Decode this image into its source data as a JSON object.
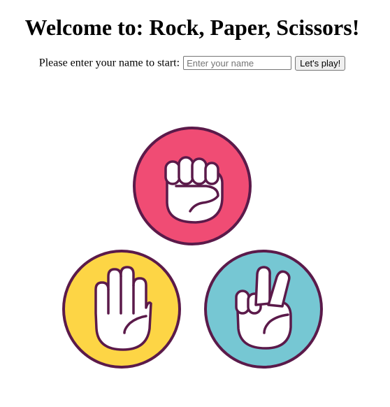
{
  "page": {
    "title": "Welcome to: Rock, Paper, Scissors!"
  },
  "name_form": {
    "prompt": "Please enter your name to start:",
    "input_placeholder": "Enter your name",
    "input_value": "",
    "button_label": "Let's play!"
  },
  "hands": [
    {
      "icon": "rock-fist-icon",
      "circle_color": "#f04c74"
    },
    {
      "icon": "paper-open-hand-icon",
      "circle_color": "#fdd545"
    },
    {
      "icon": "scissors-peace-hand-icon",
      "circle_color": "#76c7d3"
    }
  ],
  "colors": {
    "outline": "#5b1a4a",
    "hand_fill": "#ffffff"
  }
}
